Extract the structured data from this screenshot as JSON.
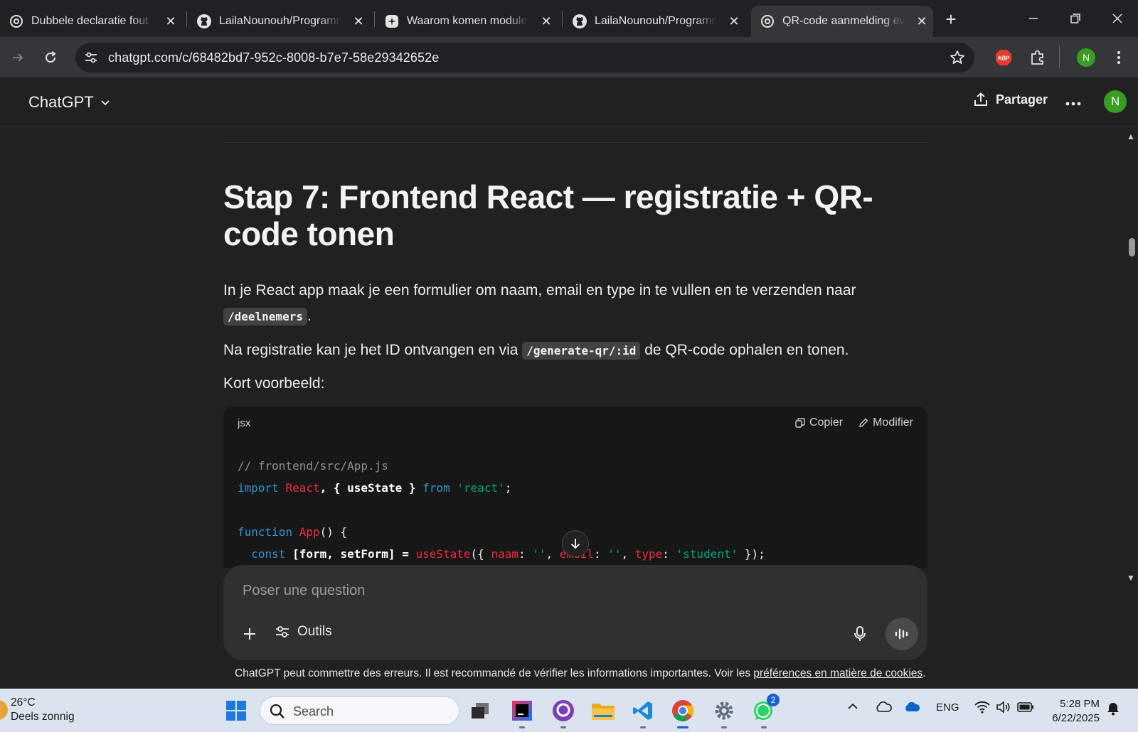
{
  "browser": {
    "tabs": [
      {
        "title": "Dubbele declaratie fout",
        "icon": "chatgpt-icon",
        "active": false
      },
      {
        "title": "LailaNounouh/Programm",
        "icon": "github-icon",
        "active": false
      },
      {
        "title": "Waarom komen module",
        "icon": "claude-icon",
        "active": false
      },
      {
        "title": "LailaNounouh/Programm",
        "icon": "github-icon",
        "active": false
      },
      {
        "title": "QR-code aanmelding eve",
        "icon": "chatgpt-icon",
        "active": true
      }
    ],
    "url": "chatgpt.com/c/68482bd7-952c-8008-b7e7-58e29342652e",
    "profile_initial": "N",
    "extension_abp": "ABP"
  },
  "app": {
    "brand": "ChatGPT",
    "share_label": "Partager",
    "user_initial": "N"
  },
  "message": {
    "heading": "Stap 7: Frontend React — registratie + QR-code tonen",
    "para1_text": "In je React app maak je een formulier om naam, email en type in te vullen en te verzenden naar",
    "para1_code": "/deelnemers",
    "para1_end": ".",
    "para2_start": "Na registratie kan je het ID ontvangen en via",
    "para2_code": "/generate-qr/:id",
    "para2_end": "de QR-code ophalen en tonen.",
    "para3": "Kort voorbeeld:"
  },
  "codeblock": {
    "language": "jsx",
    "copy_label": "Copier",
    "edit_label": "Modifier",
    "line1": "// frontend/src/App.js",
    "line2": {
      "kw": "import",
      "name": "React",
      "rest": ", { useState } ",
      "from": "from",
      "str": "'react'",
      "end": ";"
    },
    "line4": {
      "kw": "function",
      "name": "App",
      "rest": "() {"
    },
    "line5": {
      "kw": "const",
      "a": " [form, setForm] = ",
      "fn": "useState",
      "b": "({ ",
      "k1": "naam",
      "c": ": ",
      "s1": "''",
      "d": ", ",
      "k2": "email",
      "e": ": ",
      "s2": "''",
      "f": ", ",
      "k3": "type",
      "g": ": ",
      "s3": "'student'",
      "h": " });"
    }
  },
  "composer": {
    "placeholder": "Poser une question",
    "tools_label": "Outils"
  },
  "disclaimer": {
    "text": "ChatGPT peut commettre des erreurs. Il est recommandé de vérifier les informations importantes. Voir les ",
    "link": "préférences en matière de cookies",
    "end": "."
  },
  "taskbar": {
    "temperature": "26°C",
    "weather": "Deels zonnig",
    "search_label": "Search",
    "language": "ENG",
    "time": "5:28 PM",
    "date": "6/22/2025",
    "whatsapp_badge": "2"
  },
  "colors": {
    "accent_green": "#3a9d23",
    "keyword_blue": "#2e95d3",
    "string_green": "#00a67d",
    "name_red": "#f22c3d"
  }
}
